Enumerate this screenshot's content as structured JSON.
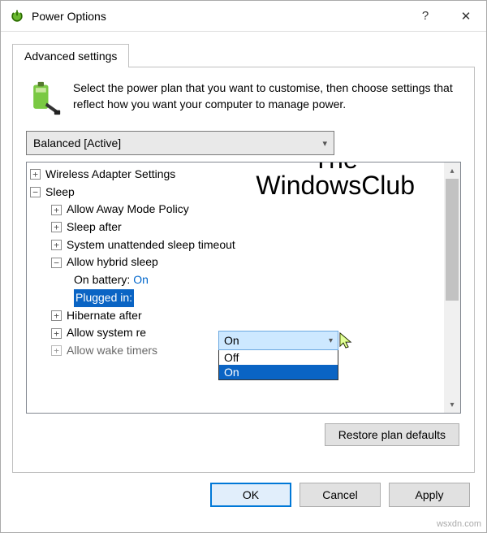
{
  "window": {
    "title": "Power Options",
    "help_tooltip": "?",
    "close_tooltip": "✕"
  },
  "tab": {
    "label": "Advanced settings"
  },
  "description": "Select the power plan that you want to customise, then choose settings that reflect how you want your computer to manage power.",
  "plan_dropdown": {
    "selected": "Balanced [Active]"
  },
  "tree": {
    "wireless": "Wireless Adapter Settings",
    "sleep": "Sleep",
    "allow_away": "Allow Away Mode Policy",
    "sleep_after": "Sleep after",
    "sys_unattended": "System unattended sleep timeout",
    "hybrid": "Allow hybrid sleep",
    "on_battery_label": "On battery:",
    "on_battery_value": "On",
    "plugged_in_label": "Plugged in:",
    "plugged_in_value": "On",
    "hibernate": "Hibernate after",
    "allow_sys_req": "Allow system re",
    "allow_wake": "Allow wake timers"
  },
  "combo": {
    "selected": "On",
    "opt_off": "Off",
    "opt_on": "On"
  },
  "buttons": {
    "restore": "Restore plan defaults",
    "ok": "OK",
    "cancel": "Cancel",
    "apply": "Apply"
  },
  "watermark": {
    "line1": "The",
    "line2": "WindowsClub",
    "site": "wsxdn.com"
  }
}
